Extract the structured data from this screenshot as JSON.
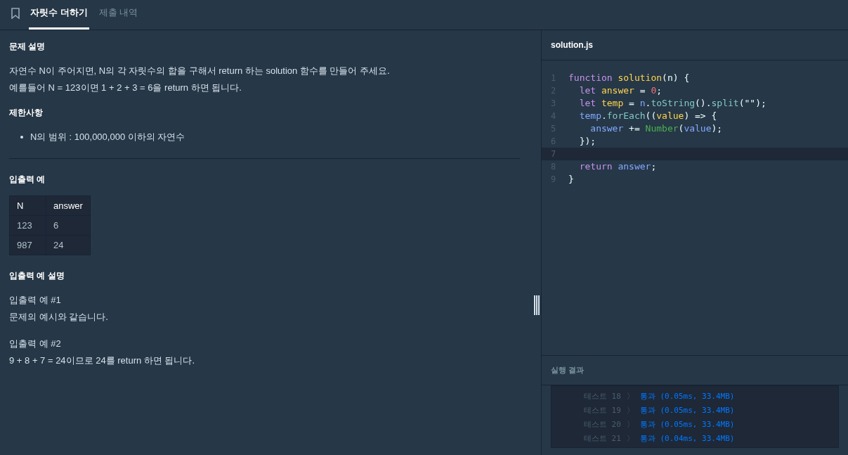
{
  "tabs": [
    {
      "label": "자릿수 더하기",
      "selected": true
    },
    {
      "label": "제출 내역",
      "selected": false
    }
  ],
  "problem": {
    "sections": [
      {
        "title": "문제 설명",
        "blocks": [
          {
            "kind": "para",
            "lines": [
              "자연수 N이 주어지면, N의 각 자릿수의 합을 구해서 return 하는 solution 함수를 만들어 주세요.",
              "예를들어 N = 123이면 1 + 2 + 3 = 6을 return 하면 됩니다."
            ]
          }
        ]
      },
      {
        "title": "제한사항",
        "blocks": [
          {
            "kind": "bullets",
            "lines": [
              "N의 범위 : 100,000,000 이하의 자연수"
            ]
          }
        ],
        "rule": true
      },
      {
        "title": "입출력 예",
        "blocks": [
          {
            "kind": "table",
            "columns": [
              "N",
              "answer"
            ],
            "rows": [
              [
                "123",
                "6"
              ],
              [
                "987",
                "24"
              ]
            ]
          }
        ]
      },
      {
        "title": "입출력 예 설명",
        "blocks": [
          {
            "kind": "para",
            "lines": [
              "입출력 예 #1",
              "문제의 예시와 같습니다."
            ]
          },
          {
            "kind": "para",
            "lines": [
              "입출력 예 #2",
              "9 + 8 + 7 = 24이므로 24를 return 하면 됩니다."
            ]
          }
        ]
      }
    ]
  },
  "editor": {
    "filename": "solution.js",
    "lines": [
      {
        "number": "1",
        "current": false,
        "tokens": [
          {
            "text": "function ",
            "kind": "keyword"
          },
          {
            "text": "solution",
            "kind": "name"
          },
          {
            "text": "(n) {",
            "kind": "plain"
          }
        ]
      },
      {
        "number": "2",
        "current": false,
        "tokens": [
          {
            "text": "  let ",
            "kind": "keyword"
          },
          {
            "text": "answer",
            "kind": "name"
          },
          {
            "text": " = ",
            "kind": "plain"
          },
          {
            "text": "0",
            "kind": "number"
          },
          {
            "text": ";",
            "kind": "plain"
          }
        ]
      },
      {
        "number": "3",
        "current": false,
        "tokens": [
          {
            "text": "  let ",
            "kind": "keyword"
          },
          {
            "text": "temp",
            "kind": "name"
          },
          {
            "text": " = ",
            "kind": "plain"
          },
          {
            "text": "n",
            "kind": "ident"
          },
          {
            "text": ".",
            "kind": "plain"
          },
          {
            "text": "toString",
            "kind": "method"
          },
          {
            "text": "().",
            "kind": "plain"
          },
          {
            "text": "split",
            "kind": "method"
          },
          {
            "text": "(\"\");",
            "kind": "plain"
          }
        ]
      },
      {
        "number": "4",
        "current": false,
        "tokens": [
          {
            "text": "  temp",
            "kind": "ident"
          },
          {
            "text": ".",
            "kind": "plain"
          },
          {
            "text": "forEach",
            "kind": "method"
          },
          {
            "text": "((",
            "kind": "plain"
          },
          {
            "text": "value",
            "kind": "name"
          },
          {
            "text": ") => {",
            "kind": "plain"
          }
        ]
      },
      {
        "number": "5",
        "current": false,
        "tokens": [
          {
            "text": "    answer",
            "kind": "ident"
          },
          {
            "text": " += ",
            "kind": "plain"
          },
          {
            "text": "Number",
            "kind": "builtin"
          },
          {
            "text": "(",
            "kind": "plain"
          },
          {
            "text": "value",
            "kind": "ident"
          },
          {
            "text": ");",
            "kind": "plain"
          }
        ]
      },
      {
        "number": "6",
        "current": false,
        "tokens": [
          {
            "text": "  });",
            "kind": "plain"
          }
        ]
      },
      {
        "number": "7",
        "current": true
      },
      {
        "number": "8",
        "current": false,
        "tokens": [
          {
            "text": "  return ",
            "kind": "keyword"
          },
          {
            "text": "answer",
            "kind": "ident"
          },
          {
            "text": ";",
            "kind": "plain"
          }
        ]
      },
      {
        "number": "9",
        "current": false,
        "tokens": [
          {
            "text": "}",
            "kind": "plain"
          }
        ]
      }
    ]
  },
  "results": {
    "title": "실행 결과",
    "tests": [
      {
        "label": "테스트 18",
        "arrow": "〉",
        "result": "통과 (0.05ms, 33.4MB)",
        "passed": true
      },
      {
        "label": "테스트 19",
        "arrow": "〉",
        "result": "통과 (0.05ms, 33.4MB)",
        "passed": true
      },
      {
        "label": "테스트 20",
        "arrow": "〉",
        "result": "통과 (0.05ms, 33.4MB)",
        "passed": true
      },
      {
        "label": "테스트 21",
        "arrow": "〉",
        "result": "통과 (0.04ms, 33.4MB)",
        "passed": true
      }
    ]
  }
}
